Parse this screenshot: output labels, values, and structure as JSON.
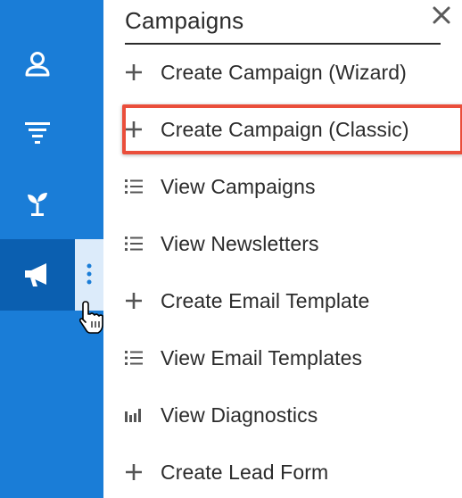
{
  "sidebar": {
    "items": [
      {
        "icon": "person-icon"
      },
      {
        "icon": "filter-icon"
      },
      {
        "icon": "sprout-icon"
      },
      {
        "icon": "megaphone-icon",
        "active": true
      }
    ],
    "accent": "#1a7dd7",
    "active_bg": "#0b5fb0"
  },
  "panel": {
    "title": "Campaigns",
    "close_icon": "close-icon",
    "items": [
      {
        "label": "Create Campaign (Wizard)",
        "icon": "plus-icon"
      },
      {
        "label": "Create Campaign (Classic)",
        "icon": "plus-icon",
        "highlighted": true
      },
      {
        "label": "View Campaigns",
        "icon": "list-icon"
      },
      {
        "label": "View Newsletters",
        "icon": "list-icon"
      },
      {
        "label": "Create Email Template",
        "icon": "plus-icon"
      },
      {
        "label": "View Email Templates",
        "icon": "list-icon"
      },
      {
        "label": "View Diagnostics",
        "icon": "bar-chart-icon"
      },
      {
        "label": "Create Lead Form",
        "icon": "plus-icon"
      }
    ],
    "highlight_color": "#ea4e3b"
  }
}
